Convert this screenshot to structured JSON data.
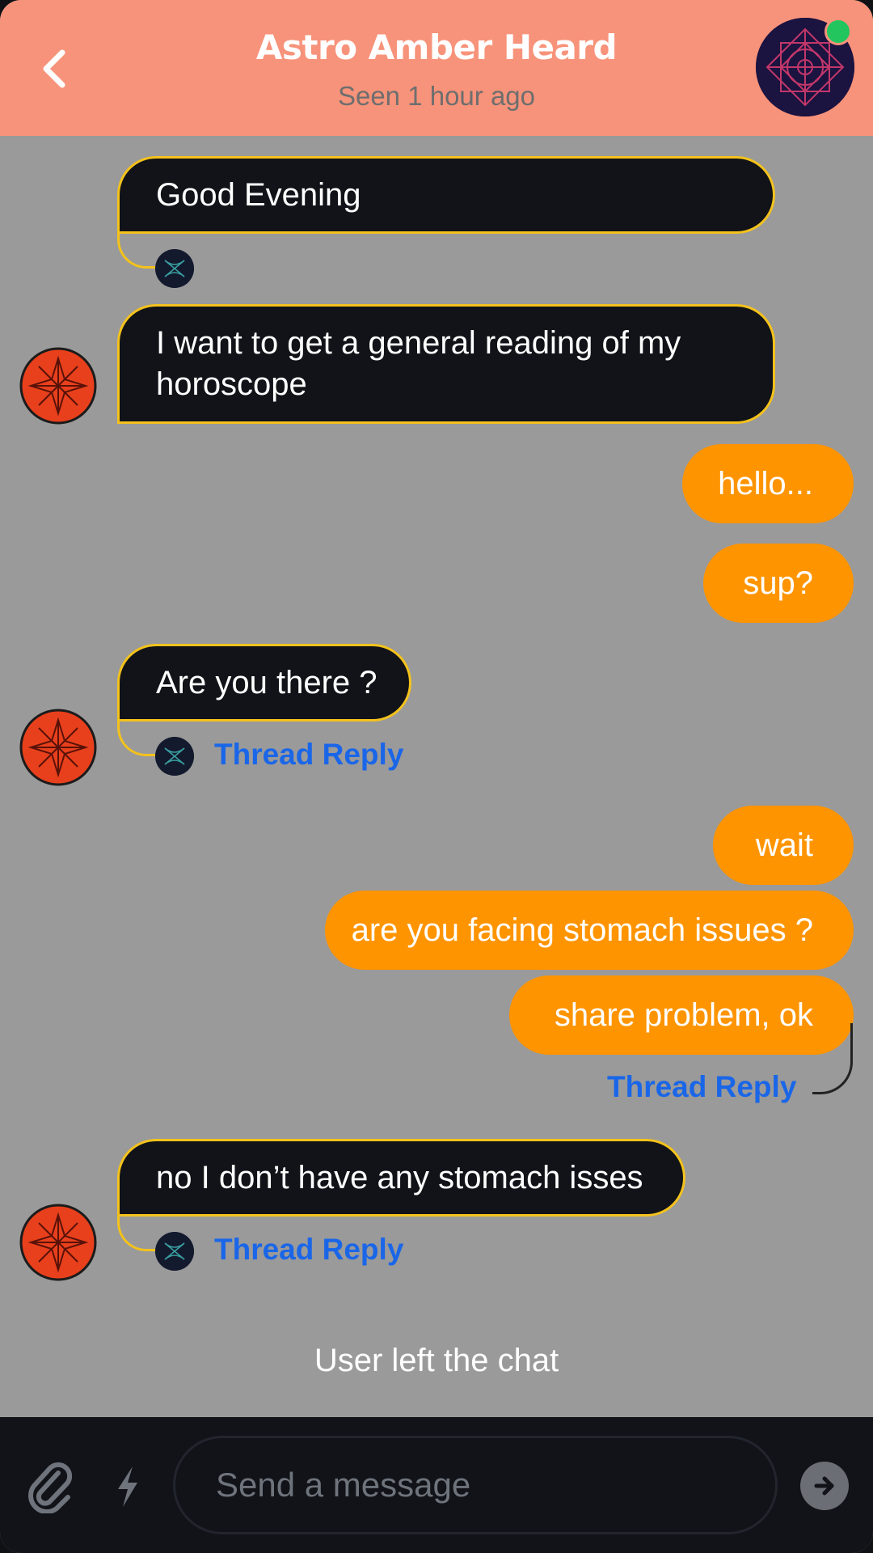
{
  "header": {
    "title": "Astro Amber Heard",
    "status": "Seen 1 hour ago",
    "back_icon": "chevron-left-icon",
    "online_color": "#22c55e",
    "background_color": "#f7937a"
  },
  "messages": [
    {
      "from": "astrologer",
      "text": "Good Evening"
    },
    {
      "from": "astrologer",
      "text": "I want to get a general reading of my horoscope"
    },
    {
      "from": "user",
      "text": "hello..."
    },
    {
      "from": "user",
      "text": "sup?"
    },
    {
      "from": "astrologer",
      "text": "Are you there ?",
      "thread_reply": "Thread Reply"
    },
    {
      "from": "user",
      "text": "wait"
    },
    {
      "from": "user",
      "text": "are you facing stomach issues ?"
    },
    {
      "from": "user",
      "text": "share problem, ok",
      "thread_reply": "Thread Reply"
    },
    {
      "from": "astrologer",
      "text": "no I  don’t have any stomach isses",
      "thread_reply": "Thread Reply"
    }
  ],
  "system_message": "User left the chat",
  "composer": {
    "placeholder": "Send a message",
    "attach_icon": "paperclip-icon",
    "commands_icon": "lightning-icon",
    "send_icon": "arrow-right-icon"
  },
  "colors": {
    "incoming_bubble": "#111318",
    "incoming_border": "#f4c21c",
    "outgoing_bubble": "#fe9400",
    "thread_reply": "#1a66e8",
    "chat_background": "#9a9a9a"
  }
}
